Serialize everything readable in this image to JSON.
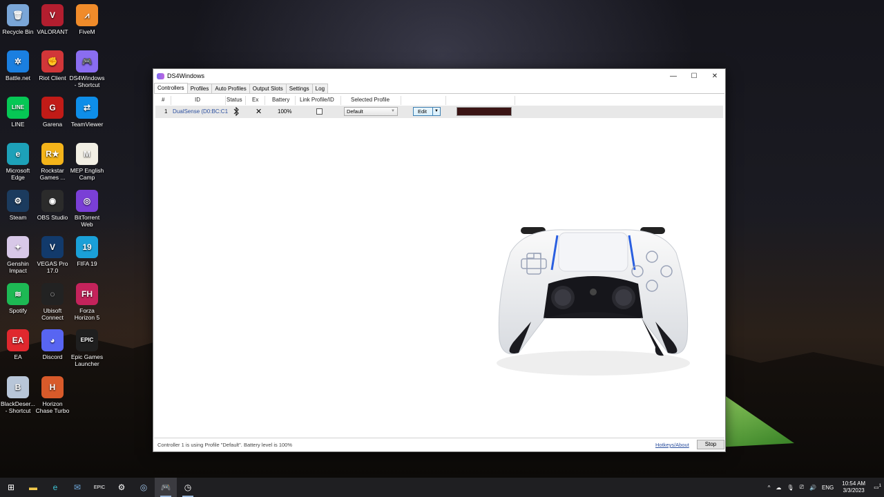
{
  "desktop": {
    "icons": [
      {
        "label": "Recycle Bin",
        "name": "recycle-bin-icon",
        "color": "#7aa6d8",
        "glyph": "🗑"
      },
      {
        "label": "VALORANT",
        "name": "valorant-icon",
        "color": "#b31e2f",
        "glyph": "V"
      },
      {
        "label": "FiveM",
        "name": "fivem-icon",
        "color": "#f08b2a",
        "glyph": "⩘"
      },
      {
        "label": "Battle.net",
        "name": "battlenet-icon",
        "color": "#1a7fe0",
        "glyph": "✲"
      },
      {
        "label": "Riot Client",
        "name": "riot-client-icon",
        "color": "#d13639",
        "glyph": "✊"
      },
      {
        "label": "DS4Windows - Shortcut",
        "name": "ds4windows-icon",
        "color": "#8a6df0",
        "glyph": "🎮"
      },
      {
        "label": "LINE",
        "name": "line-icon",
        "color": "#06c755",
        "glyph": "LINE"
      },
      {
        "label": "Garena",
        "name": "garena-icon",
        "color": "#c11b17",
        "glyph": "G"
      },
      {
        "label": "TeamViewer",
        "name": "teamviewer-icon",
        "color": "#0e8ee9",
        "glyph": "⇄"
      },
      {
        "label": "Microsoft Edge",
        "name": "edge-icon",
        "color": "#1da1b8",
        "glyph": "e"
      },
      {
        "label": "Rockstar Games ...",
        "name": "rockstar-icon",
        "color": "#f4b41a",
        "glyph": "R★"
      },
      {
        "label": "MEP English Camp",
        "name": "mep-english-camp-icon",
        "color": "#f2efe4",
        "glyph": "M"
      },
      {
        "label": "Steam",
        "name": "steam-icon",
        "color": "#1b3b5e",
        "glyph": "⚙"
      },
      {
        "label": "OBS Studio",
        "name": "obs-icon",
        "color": "#2b2b2b",
        "glyph": "◉"
      },
      {
        "label": "BitTorrent Web",
        "name": "bittorrent-icon",
        "color": "#7a3fd6",
        "glyph": "◎"
      },
      {
        "label": "Genshin Impact",
        "name": "genshin-icon",
        "color": "#d8c8e8",
        "glyph": "✦"
      },
      {
        "label": "VEGAS Pro 17.0",
        "name": "vegas-pro-icon",
        "color": "#123a6b",
        "glyph": "V"
      },
      {
        "label": "FIFA 19",
        "name": "fifa19-icon",
        "color": "#1aa0d8",
        "glyph": "19"
      },
      {
        "label": "Spotify",
        "name": "spotify-icon",
        "color": "#1db954",
        "glyph": "≋"
      },
      {
        "label": "Ubisoft Connect",
        "name": "ubisoft-icon",
        "color": "#222",
        "glyph": "◌"
      },
      {
        "label": "Forza Horizon 5",
        "name": "forza-icon",
        "color": "#c4235b",
        "glyph": "FH"
      },
      {
        "label": "EA",
        "name": "ea-icon",
        "color": "#e0282e",
        "glyph": "EA"
      },
      {
        "label": "Discord",
        "name": "discord-icon",
        "color": "#5865f2",
        "glyph": "◕"
      },
      {
        "label": "Epic Games Launcher",
        "name": "epic-games-icon",
        "color": "#1f1f1f",
        "glyph": "EPIC"
      },
      {
        "label": "BlackDeser... - Shortcut",
        "name": "blackdesert-icon",
        "color": "#b8c6d8",
        "glyph": "B"
      },
      {
        "label": "Horizon Chase Turbo",
        "name": "horizon-chase-icon",
        "color": "#d85a2a",
        "glyph": "H"
      }
    ]
  },
  "window": {
    "title": "DS4Windows",
    "tabs": [
      "Controllers",
      "Profiles",
      "Auto Profiles",
      "Output Slots",
      "Settings",
      "Log"
    ],
    "columns": [
      "#",
      "ID",
      "Status",
      "Ex",
      "Battery",
      "Link Profile/ID",
      "Selected Profile"
    ],
    "row": {
      "index": "1",
      "id": "DualSense (D0:BC:C1",
      "status_icon": "bluetooth-icon",
      "ex": "✕",
      "battery": "100%",
      "selected_profile": "Default",
      "edit_label": "Edit",
      "light_color": "#3a1414"
    },
    "status_message": "Controller 1 is using Profile \"Default\". Battery level is 100%",
    "hotkeys_link": "Hotkeys/About",
    "stop_label": "Stop"
  },
  "taskbar": {
    "language": "ENG",
    "time": "10:54 AM",
    "date": "3/3/2023",
    "notification_count": "1"
  }
}
